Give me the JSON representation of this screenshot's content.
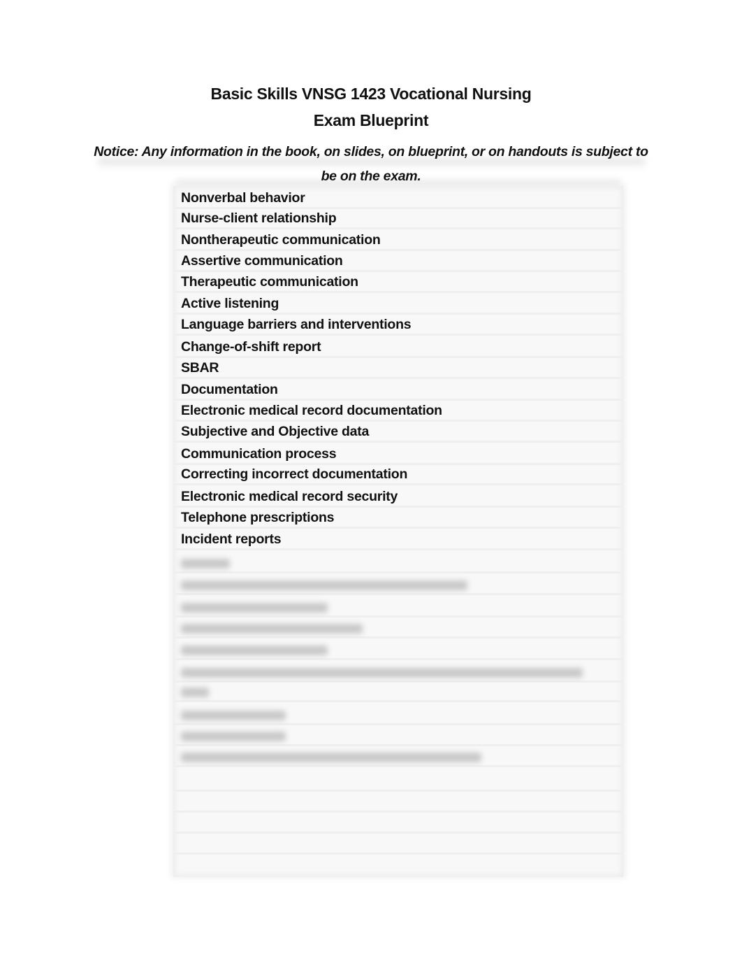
{
  "document": {
    "title": "Basic Skills VNSG 1423 Vocational Nursing",
    "subtitle": "Exam Blueprint",
    "notice": "Notice: Any information in the book, on slides, on blueprint, or on handouts is subject to be on the exam."
  },
  "blueprint_table": {
    "legible_rows": [
      "Nonverbal behavior",
      "Nurse-client relationship",
      "Nontherapeutic communication",
      "Assertive communication",
      "Therapeutic communication",
      "Active listening",
      "Language barriers and interventions",
      "Change-of-shift report",
      "SBAR",
      "Documentation",
      "Electronic medical record documentation",
      "Subjective and Objective data",
      "Communication process",
      "Correcting incorrect documentation",
      "Electronic medical record security",
      "Telephone prescriptions",
      "Incident reports"
    ],
    "blurred_row_count": 10,
    "empty_row_count": 4
  }
}
